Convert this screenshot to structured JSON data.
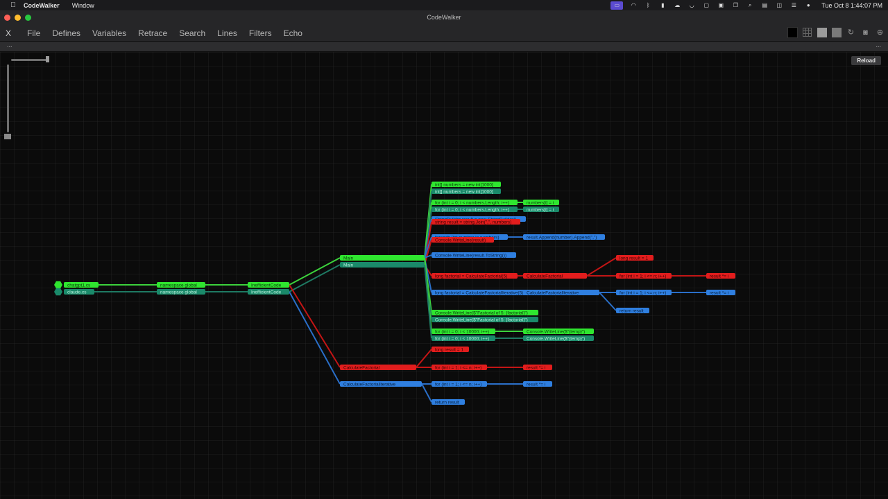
{
  "menubar": {
    "app_name": "CodeWalker",
    "menu": [
      "Window"
    ],
    "clock": "Tue Oct 8  1:44:07 PM"
  },
  "window": {
    "title": "CodeWalker"
  },
  "toolbar": {
    "close_label": "X",
    "menus": [
      "File",
      "Defines",
      "Variables",
      "Retrace",
      "Search",
      "Lines",
      "Filters",
      "Echo"
    ]
  },
  "strip": {
    "left": "...",
    "right": "..."
  },
  "canvas": {
    "reload_label": "Reload"
  },
  "colors": {
    "green": "#2fe62f",
    "teal": "#1a8a6a",
    "red": "#e21d1d",
    "blue": "#2f7fe0",
    "green_edge": "#3cd33c",
    "red_edge": "#c41515",
    "blue_edge": "#2a6fc9"
  },
  "nodes": [
    {
      "id": "f1",
      "label": "chatgpt1.cs",
      "color": "green"
    },
    {
      "id": "f2",
      "label": "claude.cs",
      "color": "teal"
    },
    {
      "id": "ns1",
      "label": "namespace global",
      "color": "green"
    },
    {
      "id": "ns2",
      "label": "namespace global",
      "color": "teal"
    },
    {
      "id": "ic1",
      "label": "InefficientCode",
      "color": "green"
    },
    {
      "id": "ic2",
      "label": "InefficientCode",
      "color": "teal"
    },
    {
      "id": "m1",
      "label": "Main",
      "color": "green"
    },
    {
      "id": "m2",
      "label": "Main",
      "color": "teal"
    },
    {
      "id": "cf",
      "label": "CalculateFactorial",
      "color": "red"
    },
    {
      "id": "cfi",
      "label": "CalculateFactorialIterative",
      "color": "blue"
    },
    {
      "id": "a1",
      "label": "int[] numbers = new int[1000]",
      "color": "green"
    },
    {
      "id": "a2",
      "label": "int[] numbers = new int[1000]",
      "color": "teal"
    },
    {
      "id": "b1",
      "label": "for (int i = 0; i < numbers.Length; i++)",
      "color": "green"
    },
    {
      "id": "b2",
      "label": "for (int i = 0; i < numbers.Length; i++)",
      "color": "teal"
    },
    {
      "id": "b1c",
      "label": "numbers[i] = i",
      "color": "green"
    },
    {
      "id": "b2c",
      "label": "numbers[i] = i",
      "color": "teal"
    },
    {
      "id": "c1",
      "label": "StringBuilder result = new StringBuilder()",
      "color": "blue"
    },
    {
      "id": "c2",
      "label": "string result = string.Join(\",\", numbers)",
      "color": "red"
    },
    {
      "id": "d1",
      "label": "foreach (int number in numbers)",
      "color": "blue"
    },
    {
      "id": "d2",
      "label": "Console.WriteLine(result)",
      "color": "red"
    },
    {
      "id": "d1c",
      "label": "result.Append(number).Append(\",\")",
      "color": "blue"
    },
    {
      "id": "e1",
      "label": "Console.WriteLine(result.ToString())",
      "color": "blue"
    },
    {
      "id": "g1",
      "label": "long factorial = CalculateFactorial(5)",
      "color": "red"
    },
    {
      "id": "g1c",
      "label": "CalculateFactorial",
      "color": "red"
    },
    {
      "id": "h1",
      "label": "long factorial = CalculateFactorialIterative(5)",
      "color": "blue"
    },
    {
      "id": "h1c",
      "label": "CalculateFactorialIterative",
      "color": "blue"
    },
    {
      "id": "r1",
      "label": "long result = 1",
      "color": "red"
    },
    {
      "id": "r2",
      "label": "for (int i = 1; i <= n; i++)",
      "color": "red"
    },
    {
      "id": "r2b",
      "label": "for (int i = 1; i <= n; i++)",
      "color": "blue"
    },
    {
      "id": "r3",
      "label": "result *= i",
      "color": "red"
    },
    {
      "id": "r4",
      "label": "result *= i",
      "color": "blue"
    },
    {
      "id": "r5",
      "label": "return result",
      "color": "blue"
    },
    {
      "id": "k1",
      "label": "Console.WriteLine($\"Factorial of 5: {factorial}\")",
      "color": "green"
    },
    {
      "id": "k2",
      "label": "Console.WriteLine($\"Factorial of 5: {factorial}\")",
      "color": "teal"
    },
    {
      "id": "l1",
      "label": "for (int i = 0; i < 10000; i++)",
      "color": "green"
    },
    {
      "id": "l2",
      "label": "for (int i = 0; i < 10000; i++)",
      "color": "teal"
    },
    {
      "id": "l1c",
      "label": "Console.WriteLine($\"{temp}\")",
      "color": "green"
    },
    {
      "id": "l2c",
      "label": "Console.WriteLine($\"{temp}\")",
      "color": "teal"
    },
    {
      "id": "s1",
      "label": "long result = 1",
      "color": "red"
    },
    {
      "id": "s2",
      "label": "for (int i = 1; i <= n; i++)",
      "color": "red"
    },
    {
      "id": "s3",
      "label": "result *= i",
      "color": "red"
    },
    {
      "id": "t1",
      "label": "for (int i = 1; i <= n; i++)",
      "color": "blue"
    },
    {
      "id": "t2",
      "label": "result *= i",
      "color": "blue"
    },
    {
      "id": "t3",
      "label": "return result",
      "color": "blue"
    }
  ]
}
